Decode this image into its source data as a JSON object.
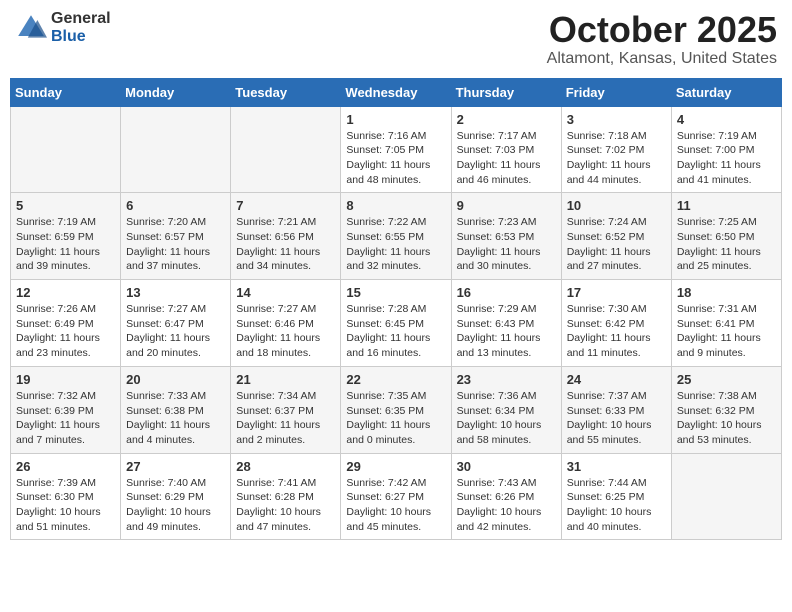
{
  "logo": {
    "general": "General",
    "blue": "Blue"
  },
  "header": {
    "title": "October 2025",
    "subtitle": "Altamont, Kansas, United States"
  },
  "weekdays": [
    "Sunday",
    "Monday",
    "Tuesday",
    "Wednesday",
    "Thursday",
    "Friday",
    "Saturday"
  ],
  "weeks": [
    [
      {
        "day": "",
        "info": ""
      },
      {
        "day": "",
        "info": ""
      },
      {
        "day": "",
        "info": ""
      },
      {
        "day": "1",
        "info": "Sunrise: 7:16 AM\nSunset: 7:05 PM\nDaylight: 11 hours\nand 48 minutes."
      },
      {
        "day": "2",
        "info": "Sunrise: 7:17 AM\nSunset: 7:03 PM\nDaylight: 11 hours\nand 46 minutes."
      },
      {
        "day": "3",
        "info": "Sunrise: 7:18 AM\nSunset: 7:02 PM\nDaylight: 11 hours\nand 44 minutes."
      },
      {
        "day": "4",
        "info": "Sunrise: 7:19 AM\nSunset: 7:00 PM\nDaylight: 11 hours\nand 41 minutes."
      }
    ],
    [
      {
        "day": "5",
        "info": "Sunrise: 7:19 AM\nSunset: 6:59 PM\nDaylight: 11 hours\nand 39 minutes."
      },
      {
        "day": "6",
        "info": "Sunrise: 7:20 AM\nSunset: 6:57 PM\nDaylight: 11 hours\nand 37 minutes."
      },
      {
        "day": "7",
        "info": "Sunrise: 7:21 AM\nSunset: 6:56 PM\nDaylight: 11 hours\nand 34 minutes."
      },
      {
        "day": "8",
        "info": "Sunrise: 7:22 AM\nSunset: 6:55 PM\nDaylight: 11 hours\nand 32 minutes."
      },
      {
        "day": "9",
        "info": "Sunrise: 7:23 AM\nSunset: 6:53 PM\nDaylight: 11 hours\nand 30 minutes."
      },
      {
        "day": "10",
        "info": "Sunrise: 7:24 AM\nSunset: 6:52 PM\nDaylight: 11 hours\nand 27 minutes."
      },
      {
        "day": "11",
        "info": "Sunrise: 7:25 AM\nSunset: 6:50 PM\nDaylight: 11 hours\nand 25 minutes."
      }
    ],
    [
      {
        "day": "12",
        "info": "Sunrise: 7:26 AM\nSunset: 6:49 PM\nDaylight: 11 hours\nand 23 minutes."
      },
      {
        "day": "13",
        "info": "Sunrise: 7:27 AM\nSunset: 6:47 PM\nDaylight: 11 hours\nand 20 minutes."
      },
      {
        "day": "14",
        "info": "Sunrise: 7:27 AM\nSunset: 6:46 PM\nDaylight: 11 hours\nand 18 minutes."
      },
      {
        "day": "15",
        "info": "Sunrise: 7:28 AM\nSunset: 6:45 PM\nDaylight: 11 hours\nand 16 minutes."
      },
      {
        "day": "16",
        "info": "Sunrise: 7:29 AM\nSunset: 6:43 PM\nDaylight: 11 hours\nand 13 minutes."
      },
      {
        "day": "17",
        "info": "Sunrise: 7:30 AM\nSunset: 6:42 PM\nDaylight: 11 hours\nand 11 minutes."
      },
      {
        "day": "18",
        "info": "Sunrise: 7:31 AM\nSunset: 6:41 PM\nDaylight: 11 hours\nand 9 minutes."
      }
    ],
    [
      {
        "day": "19",
        "info": "Sunrise: 7:32 AM\nSunset: 6:39 PM\nDaylight: 11 hours\nand 7 minutes."
      },
      {
        "day": "20",
        "info": "Sunrise: 7:33 AM\nSunset: 6:38 PM\nDaylight: 11 hours\nand 4 minutes."
      },
      {
        "day": "21",
        "info": "Sunrise: 7:34 AM\nSunset: 6:37 PM\nDaylight: 11 hours\nand 2 minutes."
      },
      {
        "day": "22",
        "info": "Sunrise: 7:35 AM\nSunset: 6:35 PM\nDaylight: 11 hours\nand 0 minutes."
      },
      {
        "day": "23",
        "info": "Sunrise: 7:36 AM\nSunset: 6:34 PM\nDaylight: 10 hours\nand 58 minutes."
      },
      {
        "day": "24",
        "info": "Sunrise: 7:37 AM\nSunset: 6:33 PM\nDaylight: 10 hours\nand 55 minutes."
      },
      {
        "day": "25",
        "info": "Sunrise: 7:38 AM\nSunset: 6:32 PM\nDaylight: 10 hours\nand 53 minutes."
      }
    ],
    [
      {
        "day": "26",
        "info": "Sunrise: 7:39 AM\nSunset: 6:30 PM\nDaylight: 10 hours\nand 51 minutes."
      },
      {
        "day": "27",
        "info": "Sunrise: 7:40 AM\nSunset: 6:29 PM\nDaylight: 10 hours\nand 49 minutes."
      },
      {
        "day": "28",
        "info": "Sunrise: 7:41 AM\nSunset: 6:28 PM\nDaylight: 10 hours\nand 47 minutes."
      },
      {
        "day": "29",
        "info": "Sunrise: 7:42 AM\nSunset: 6:27 PM\nDaylight: 10 hours\nand 45 minutes."
      },
      {
        "day": "30",
        "info": "Sunrise: 7:43 AM\nSunset: 6:26 PM\nDaylight: 10 hours\nand 42 minutes."
      },
      {
        "day": "31",
        "info": "Sunrise: 7:44 AM\nSunset: 6:25 PM\nDaylight: 10 hours\nand 40 minutes."
      },
      {
        "day": "",
        "info": ""
      }
    ]
  ]
}
